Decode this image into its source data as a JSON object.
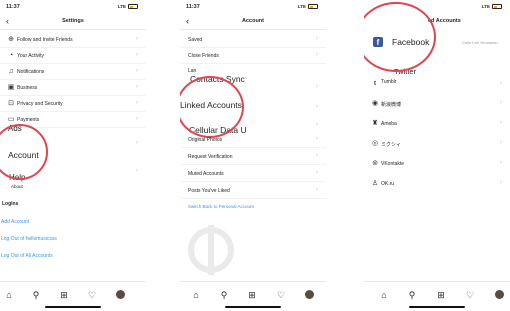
{
  "settings": {
    "time": "11:37",
    "signal": "LTE",
    "title": "Settings",
    "rows": [
      {
        "label": "Follow and Invite Friends",
        "icon": "person-plus-icon"
      },
      {
        "label": "Your Activity",
        "icon": "activity-icon"
      },
      {
        "label": "Notifications",
        "icon": "bell-icon"
      },
      {
        "label": "Business",
        "icon": "business-icon"
      },
      {
        "label": "Privacy and Security",
        "icon": "lock-icon"
      },
      {
        "label": "Payments",
        "icon": "card-icon"
      }
    ],
    "overlay_ads": "Ads",
    "overlay_account": "Account",
    "overlay_help": "Help",
    "overlay_about": "About",
    "logins_header": "Logins",
    "add_account": "Add Account",
    "log_out_user": "Log Out of hellomusicsss",
    "log_out_all": "Log Out of All Accounts"
  },
  "account": {
    "time": "11:37",
    "signal": "LTE",
    "title": "Account",
    "top_rows": [
      "Saved",
      "Close Friends"
    ],
    "partial_row": "Lan",
    "overlay_contacts_sync": "Contacts Sync",
    "overlay_linked_accounts": "Linked Accounts",
    "overlay_cellular_data": "Cellular Data U",
    "bottom_rows": [
      "Original Photos",
      "Request Verification",
      "Muted Accounts",
      "Posts You've Liked"
    ],
    "switch_link": "Switch Back to Personal Account"
  },
  "linked": {
    "signal": "LTE",
    "title_partial": "ed Accounts",
    "facebook": "Facebook",
    "facebook_sub": "Cello Lee Yeunseon",
    "overlay_twitter": "Twitter",
    "rows": [
      {
        "label": "Tumblr",
        "icon": "tumblr-icon"
      },
      {
        "label": "新浪微博",
        "icon": "weibo-icon"
      },
      {
        "label": "Ameba",
        "icon": "ameba-icon"
      },
      {
        "label": "ミクシィ",
        "icon": "mixi-icon"
      },
      {
        "label": "VKontakte",
        "icon": "vk-icon"
      },
      {
        "label": "OK.ru",
        "icon": "okru-icon"
      }
    ]
  },
  "colors": {
    "highlight_ring": "#e0454f",
    "link_blue": "#3897f0",
    "facebook_blue": "#3b5998"
  },
  "tabbar_icons": [
    "home-icon",
    "search-icon",
    "add-post-icon",
    "heart-icon",
    "profile-avatar"
  ]
}
